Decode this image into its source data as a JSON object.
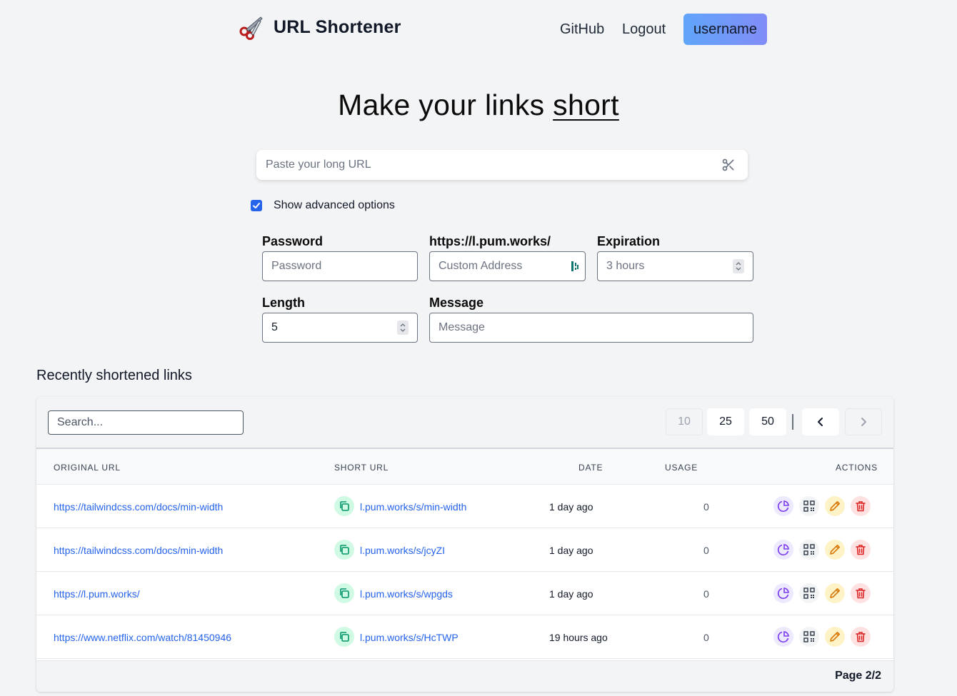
{
  "header": {
    "title": "URL Shortener",
    "nav": {
      "github": "GitHub",
      "logout": "Logout",
      "user": "username"
    }
  },
  "hero": {
    "prefix": "Make your links ",
    "emphasis": "short"
  },
  "url_input": {
    "placeholder": "Paste your long URL",
    "value": ""
  },
  "advanced": {
    "checkbox_label": "Show advanced options",
    "checked": true,
    "password": {
      "label": "Password",
      "placeholder": "Password"
    },
    "custom": {
      "label": "https://l.pum.works/",
      "placeholder": "Custom Address"
    },
    "expiration": {
      "label": "Expiration",
      "value": "3 hours"
    },
    "length": {
      "label": "Length",
      "value": "5"
    },
    "message": {
      "label": "Message",
      "placeholder": "Message"
    }
  },
  "recent": {
    "title": "Recently shortened links",
    "search_placeholder": "Search...",
    "page_sizes": [
      "10",
      "25",
      "50"
    ],
    "columns": {
      "original": "ORIGINAL URL",
      "short": "SHORT URL",
      "date": "DATE",
      "usage": "USAGE",
      "actions": "ACTIONS"
    },
    "rows": [
      {
        "original": "https://tailwindcss.com/docs/min-width",
        "short": "l.pum.works/s/min-width",
        "date": "1 day ago",
        "usage": "0"
      },
      {
        "original": "https://tailwindcss.com/docs/min-width",
        "short": "l.pum.works/s/jcyZI",
        "date": "1 day ago",
        "usage": "0"
      },
      {
        "original": "https://l.pum.works/",
        "short": "l.pum.works/s/wpgds",
        "date": "1 day ago",
        "usage": "0"
      },
      {
        "original": "https://www.netflix.com/watch/81450946",
        "short": "l.pum.works/s/HcTWP",
        "date": "19 hours ago",
        "usage": "0"
      }
    ],
    "page_indicator": "Page 2/2"
  },
  "colors": {
    "accent_blue": "#2563eb",
    "user_gradient_start": "#60a5fa",
    "user_gradient_end": "#818cf8",
    "copy_green": "#10b981",
    "stats_purple": "#7c3aed",
    "edit_yellow": "#d97706",
    "delete_red": "#dc2626"
  },
  "icons": {
    "brand": "scissors-icon",
    "url_action": "scissors-icon",
    "row_actions": [
      "pie-chart-icon",
      "qr-code-icon",
      "pencil-icon",
      "trash-icon"
    ]
  }
}
